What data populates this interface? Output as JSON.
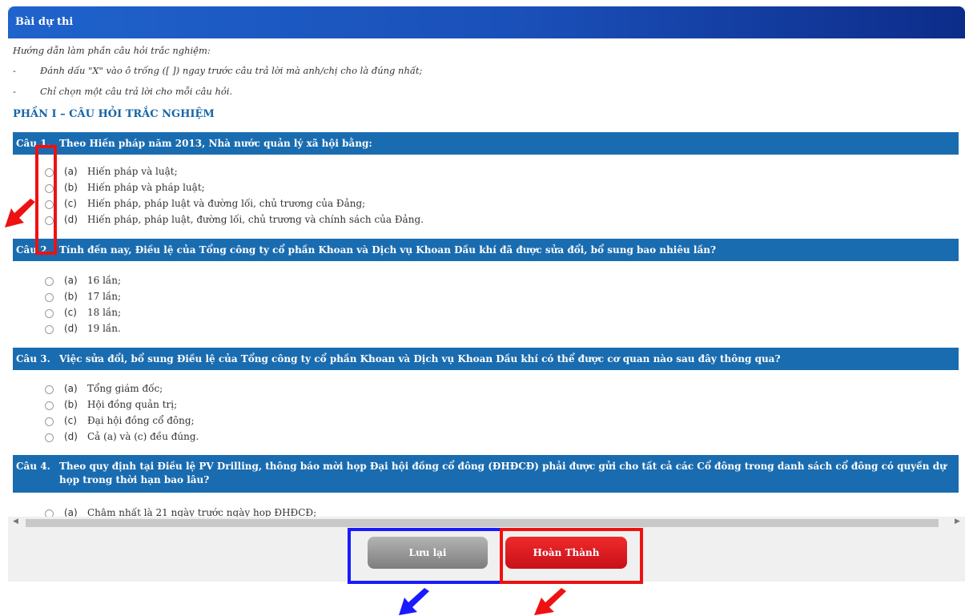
{
  "panel": {
    "title": "Bài dự thi"
  },
  "instructions": {
    "heading": "Hướng dẫn làm phần câu hỏi trắc nghiệm:",
    "items": [
      {
        "bullet": "-",
        "text": "Đánh dấu \"X\" vào ô trống ([ ]) ngay trước câu trả lời mà anh/chị cho là đúng nhất;"
      },
      {
        "bullet": "-",
        "text": "Chỉ chọn một câu trả lời cho mỗi câu hỏi."
      }
    ]
  },
  "section_title": "PHẦN I – CÂU HỎI TRẮC NGHIỆM",
  "questions": [
    {
      "number": "Câu 1.",
      "text": "Theo Hiến pháp năm 2013, Nhà nước quản lý xã hội bằng:",
      "options": [
        {
          "letter": "(a)",
          "text": "Hiến pháp và luật;",
          "selected": false
        },
        {
          "letter": "(b)",
          "text": "Hiến pháp và pháp luật;",
          "selected": false
        },
        {
          "letter": "(c)",
          "text": "Hiến pháp, pháp luật và đường lối, chủ trương của Đảng;",
          "selected": false
        },
        {
          "letter": "(d)",
          "text": "Hiến pháp, pháp luật, đường lối, chủ trương và chính sách của Đảng.",
          "selected": false
        }
      ]
    },
    {
      "number": "Câu 2.",
      "text": "Tính đến nay, Điều lệ của Tổng công ty cổ phần Khoan và Dịch vụ Khoan Dầu khí đã được sửa đổi, bổ sung bao nhiêu lần?",
      "options": [
        {
          "letter": "(a)",
          "text": "16 lần;",
          "selected": false
        },
        {
          "letter": "(b)",
          "text": "17 lần;",
          "selected": false
        },
        {
          "letter": "(c)",
          "text": "18 lần;",
          "selected": false
        },
        {
          "letter": "(d)",
          "text": "19 lần.",
          "selected": false
        }
      ]
    },
    {
      "number": "Câu 3.",
      "text": "Việc sửa đổi, bổ sung Điều lệ của Tổng công ty cổ phần Khoan và Dịch vụ Khoan Dầu khí có thể được cơ quan nào sau đây thông qua?",
      "options": [
        {
          "letter": "(a)",
          "text": "Tổng giám đốc;",
          "selected": false
        },
        {
          "letter": "(b)",
          "text": "Hội đồng quản trị;",
          "selected": false
        },
        {
          "letter": "(c)",
          "text": "Đại hội đồng cổ đông;",
          "selected": false
        },
        {
          "letter": "(d)",
          "text": "Cả (a) và (c) đều đúng.",
          "selected": false
        }
      ]
    },
    {
      "number": "Câu 4.",
      "text": "Theo quy định tại Điều lệ PV Drilling, thông báo mời họp Đại hội đồng cổ đông (ĐHĐCĐ) phải được gửi cho tất cả các Cổ đông trong danh sách cổ đông có quyền dự họp trong thời hạn bao lâu?",
      "options": [
        {
          "letter": "(a)",
          "text": "Chậm nhất là 21 ngày trước ngày họp ĐHĐCĐ;",
          "selected": false
        }
      ]
    }
  ],
  "scrollbar": {
    "left_arrow": "◀",
    "right_arrow": "▶"
  },
  "buttons": {
    "save": "Lưu lại",
    "finish": "Hoàn Thành"
  },
  "annotation_colors": {
    "red": "#ee1111",
    "blue": "#1a1aff"
  }
}
